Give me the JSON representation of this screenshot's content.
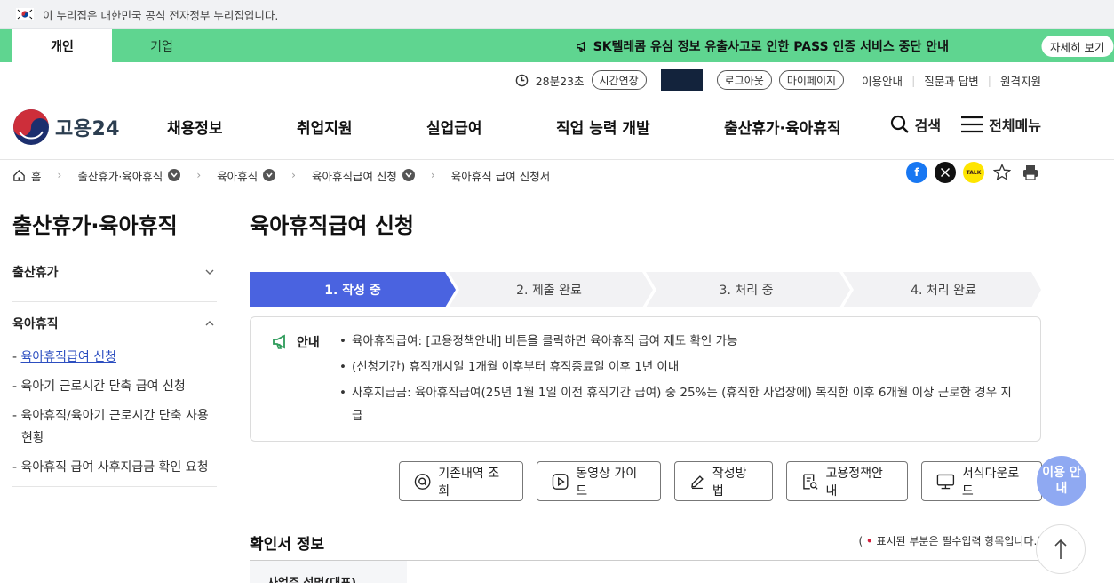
{
  "gov_banner": {
    "text": "이 누리집은 대한민국 공식 전자정부 누리집입니다.",
    "icon": "taegeuk-flag-icon"
  },
  "top_tabs": [
    {
      "label": "개인",
      "active": true
    },
    {
      "label": "기업",
      "active": false
    }
  ],
  "notice": {
    "text": "SK텔레콤 유심 정보 유출사고로 인한 PASS 인증 서비스 중단 안내",
    "button": "자세히 보기",
    "icon": "megaphone-icon"
  },
  "util": {
    "timer": "28분23초",
    "extend": "시간연장",
    "logout": "로그아웃",
    "mypage": "마이페이지",
    "links": [
      "이용안내",
      "질문과 답변",
      "원격지원"
    ]
  },
  "header": {
    "logo_text": "고용24",
    "gnb": [
      "채용정보",
      "취업지원",
      "실업급여",
      "직업 능력 개발",
      "출산휴가·육아휴직"
    ],
    "search": "검색",
    "all_menu": "전체메뉴"
  },
  "breadcrumb": [
    "홈",
    "출산휴가·육아휴직",
    "육아휴직",
    "육아휴직급여 신청",
    "육아휴직 급여 신청서"
  ],
  "share_icons": {
    "facebook": "f",
    "kakao": "TALK"
  },
  "lnb": {
    "title": "출산휴가·육아휴직",
    "sections": [
      {
        "label": "출산휴가",
        "expanded": false
      },
      {
        "label": "육아휴직",
        "expanded": true
      }
    ],
    "items": [
      "육아휴직급여 신청",
      "육아기 근로시간 단축 급여 신청",
      "육아휴직/육아기 근로시간 단축 사용 현황",
      "육아휴직 급여 사후지급금 확인 요청"
    ]
  },
  "page_title": "육아휴직급여 신청",
  "steps": [
    {
      "label": "1. 작성 중",
      "active": true
    },
    {
      "label": "2. 제출 완료",
      "active": false
    },
    {
      "label": "3. 처리 중",
      "active": false
    },
    {
      "label": "4. 처리 완료",
      "active": false
    }
  ],
  "info": {
    "label": "안내",
    "items": [
      "육아휴직급여: [고용정책안내] 버튼을 클릭하면 육아휴직 급여 제도 확인 가능",
      "(신청기간) 휴직개시일 1개월 이후부터 휴직종료일 이후 1년 이내",
      "사후지급금: 육아휴직급여(25년 1월 1일 이전 휴직기간 급여) 중 25%는 (휴직한 사업장에) 복직한 이후 6개월 이상 근로한 경우 지급"
    ]
  },
  "tool_buttons": [
    "기존내역 조회",
    "동영상 가이드",
    "작성방법",
    "고용정책안내",
    "서식다운로드"
  ],
  "section": {
    "title": "확인서 정보",
    "note_prefix": "( ",
    "note_dot": "•",
    "note_text": " 표시된 부분은 필수입력 항목입니다.)",
    "first_field": "사업주 성명(대표)"
  },
  "float": {
    "guide": "이용 안내"
  },
  "colors": {
    "green": "#5fd590",
    "step_active": "#4a63e0",
    "accent_dot": "#d21f3c"
  }
}
